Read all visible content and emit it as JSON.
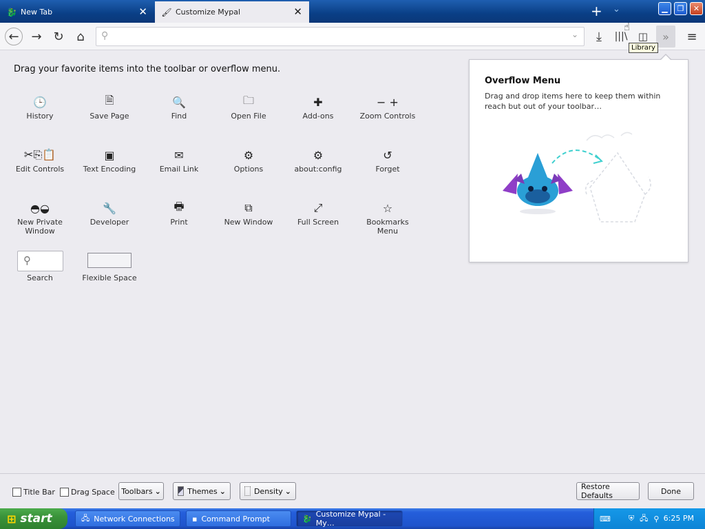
{
  "tabs": [
    {
      "label": "New Tab",
      "icon": "dragon-icon"
    },
    {
      "label": "Customize Mypal",
      "icon": "paintbrush-icon"
    }
  ],
  "tooltip": "Library",
  "heading": "Drag your favorite items into the toolbar or overflow menu.",
  "palette": [
    {
      "label": "History",
      "icon": "clock-icon",
      "glyph": "🕒"
    },
    {
      "label": "Save Page",
      "icon": "save-page-icon",
      "glyph": "🗎"
    },
    {
      "label": "Find",
      "icon": "magnifier-icon",
      "glyph": "🔍"
    },
    {
      "label": "Open File",
      "icon": "folder-icon",
      "glyph": "🗀"
    },
    {
      "label": "Add-ons",
      "icon": "puzzle-icon",
      "glyph": "✚"
    },
    {
      "label": "Zoom Controls",
      "icon": "zoom-icon",
      "glyph": "−  +"
    },
    {
      "label": "Edit Controls",
      "icon": "scissors-icon",
      "glyph": "✂⎘📋"
    },
    {
      "label": "Text Encoding",
      "icon": "encoding-icon",
      "glyph": "▣"
    },
    {
      "label": "Email Link",
      "icon": "envelope-icon",
      "glyph": "✉"
    },
    {
      "label": "Options",
      "icon": "gear-icon",
      "glyph": "⚙"
    },
    {
      "label": "about:config",
      "icon": "gear-icon",
      "glyph": "⚙"
    },
    {
      "label": "Forget",
      "icon": "forget-icon",
      "glyph": "↺"
    },
    {
      "label": "New Private\nWindow",
      "icon": "mask-icon",
      "glyph": "◓◒"
    },
    {
      "label": "Developer",
      "icon": "wrench-icon",
      "glyph": "🔧"
    },
    {
      "label": "Print",
      "icon": "printer-icon",
      "glyph": "🖶"
    },
    {
      "label": "New Window",
      "icon": "new-window-icon",
      "glyph": "⧉"
    },
    {
      "label": "Full Screen",
      "icon": "fullscreen-icon",
      "glyph": "⤢"
    },
    {
      "label": "Bookmarks\nMenu",
      "icon": "star-icon",
      "glyph": "☆"
    }
  ],
  "search_label": "Search",
  "flex_label": "Flexible Space",
  "overflow": {
    "title": "Overflow Menu",
    "desc": "Drag and drop items here to keep them within reach but out of your toolbar…"
  },
  "bottom": {
    "title_bar": "Title Bar",
    "drag_space": "Drag Space",
    "toolbars": "Toolbars",
    "themes": "Themes",
    "density": "Density",
    "restore": "Restore Defaults",
    "done": "Done"
  },
  "taskbar": {
    "start": "start",
    "tasks": [
      "Network Connections",
      "Command Prompt",
      "Customize Mypal - My…"
    ],
    "clock": "6:25 PM"
  }
}
